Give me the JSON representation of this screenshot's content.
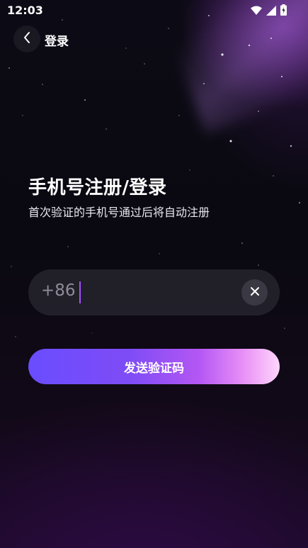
{
  "status_bar": {
    "time": "12:03",
    "icons": [
      "wifi-icon",
      "cellular-signal-icon",
      "battery-charging-icon"
    ]
  },
  "nav": {
    "back_icon": "chevron-left-icon",
    "title": "登录"
  },
  "headline": {
    "title": "手机号注册/登录",
    "subtitle": "首次验证的手机号通过后将自动注册"
  },
  "phone": {
    "country_code": "+86",
    "value": "",
    "clear_icon": "close-icon"
  },
  "actions": {
    "send_code_label": "发送验证码"
  },
  "colors": {
    "background": "#0a0911",
    "accent_start": "#6a4dff",
    "accent_end": "#ffd6fb",
    "input_bg": "#26242e",
    "cursor": "#a050ff"
  }
}
